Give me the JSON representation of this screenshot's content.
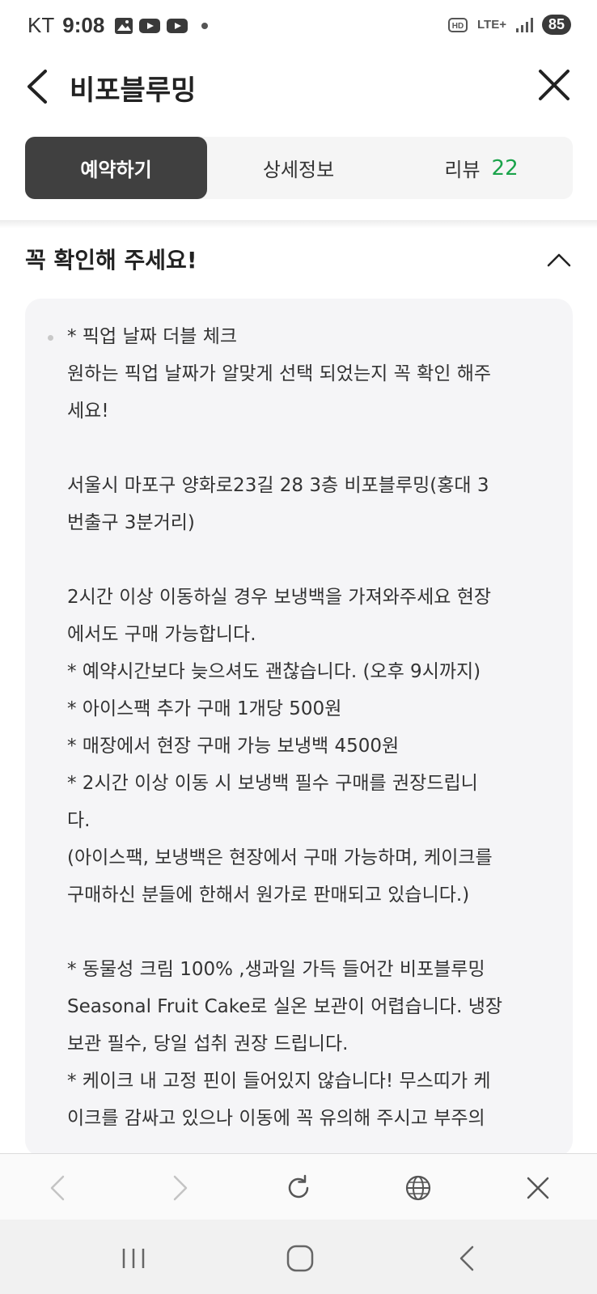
{
  "status_bar": {
    "carrier": "KT",
    "time": "9:08",
    "network": "LTE+",
    "battery": "85"
  },
  "header": {
    "title": "비포블루밍"
  },
  "tabs": [
    {
      "label": "예약하기",
      "active": true
    },
    {
      "label": "상세정보",
      "active": false
    },
    {
      "label": "리뷰",
      "count": "22",
      "active": false
    }
  ],
  "notice": {
    "title": "꼭 확인해 주세요!",
    "lines": [
      "* 픽업 날짜 더블 체크",
      "원하는 픽업 날짜가 알맞게 선택 되었는지 꼭 확인 해주",
      "세요!",
      "",
      "서울시 마포구 양화로23길 28 3층 비포블루밍(홍대 3",
      "번출구 3분거리)",
      "",
      "2시간 이상 이동하실 경우 보냉백을 가져와주세요 현장",
      "에서도 구매 가능합니다.",
      "* 예약시간보다 늦으셔도 괜찮습니다. (오후 9시까지)",
      "* 아이스팩 추가 구매 1개당 500원",
      "* 매장에서 현장 구매 가능 보냉백 4500원",
      "* 2시간 이상 이동 시 보냉백 필수 구매를 권장드립니",
      "다.",
      "(아이스팩, 보냉백은 현장에서 구매 가능하며, 케이크를",
      "구매하신 분들에 한해서 원가로 판매되고 있습니다.)",
      "",
      "* 동물성 크림 100% ,생과일 가득 들어간 비포블루밍",
      "Seasonal Fruit Cake로 실온 보관이 어렵습니다. 냉장",
      "보관 필수, 당일 섭취 권장 드립니다.",
      "* 케이크 내 고정 핀이 들어있지 않습니다! 무스띠가 케",
      "이크를 감싸고 있으나 이동에 꼭 유의해 주시고 부주의"
    ]
  },
  "colors": {
    "active_tab": "#404040",
    "count_green": "#1aa34a",
    "card_bg": "#f5f5f7"
  }
}
